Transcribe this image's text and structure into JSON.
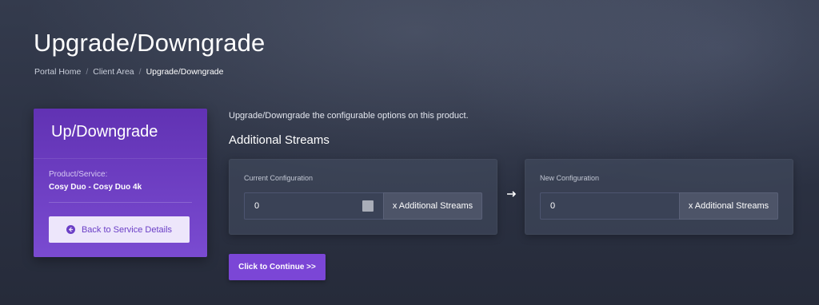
{
  "page": {
    "title": "Upgrade/Downgrade"
  },
  "breadcrumb": {
    "items": [
      "Portal Home",
      "Client Area",
      "Upgrade/Downgrade"
    ],
    "separator": "/"
  },
  "sidebar": {
    "title": "Up/Downgrade",
    "product_label": "Product/Service:",
    "product_value": "Cosy Duo - Cosy Duo 4k",
    "back_button_label": "Back to Service Details",
    "back_icon": "circle-arrow-left-icon"
  },
  "main": {
    "intro": "Upgrade/Downgrade the configurable options on this product.",
    "section_heading": "Additional Streams",
    "current": {
      "label": "Current Configuration",
      "value": "0",
      "addon": "x Additional Streams"
    },
    "arrow_icon": "arrow-right-icon",
    "new": {
      "label": "New Configuration",
      "value": "0",
      "addon": "x Additional Streams"
    },
    "continue_label": "Click to Continue >>"
  },
  "colors": {
    "accent_purple": "#7b46d6",
    "sidebar_top": "#6132b3",
    "sidebar_bottom": "#7a4bd1",
    "background": "#2b3142",
    "panel": "#3e4558"
  }
}
